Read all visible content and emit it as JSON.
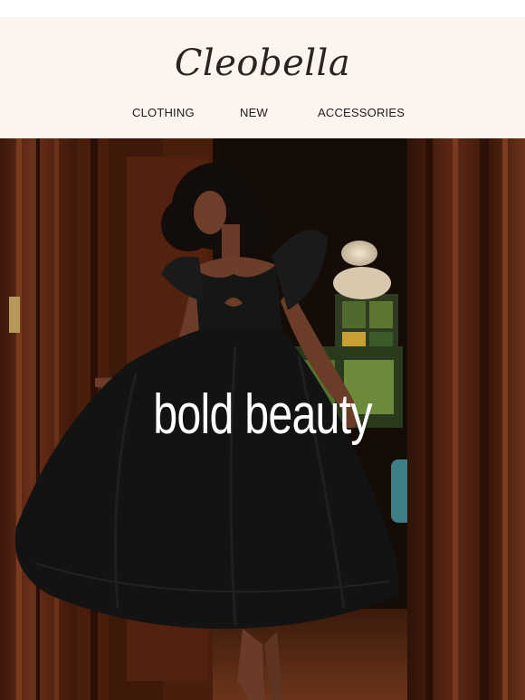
{
  "brand": {
    "logo_text": "Cleobella"
  },
  "nav": {
    "items": [
      {
        "label": "CLOTHING"
      },
      {
        "label": "NEW"
      },
      {
        "label": "ACCESSORIES"
      }
    ]
  },
  "hero": {
    "headline": "bold beauty"
  },
  "colors": {
    "header_bg": "#fdf4ef",
    "text_dark": "#1c1c1c",
    "headline": "#ffffff",
    "wood": "#5a2a17",
    "dress": "#151515"
  }
}
